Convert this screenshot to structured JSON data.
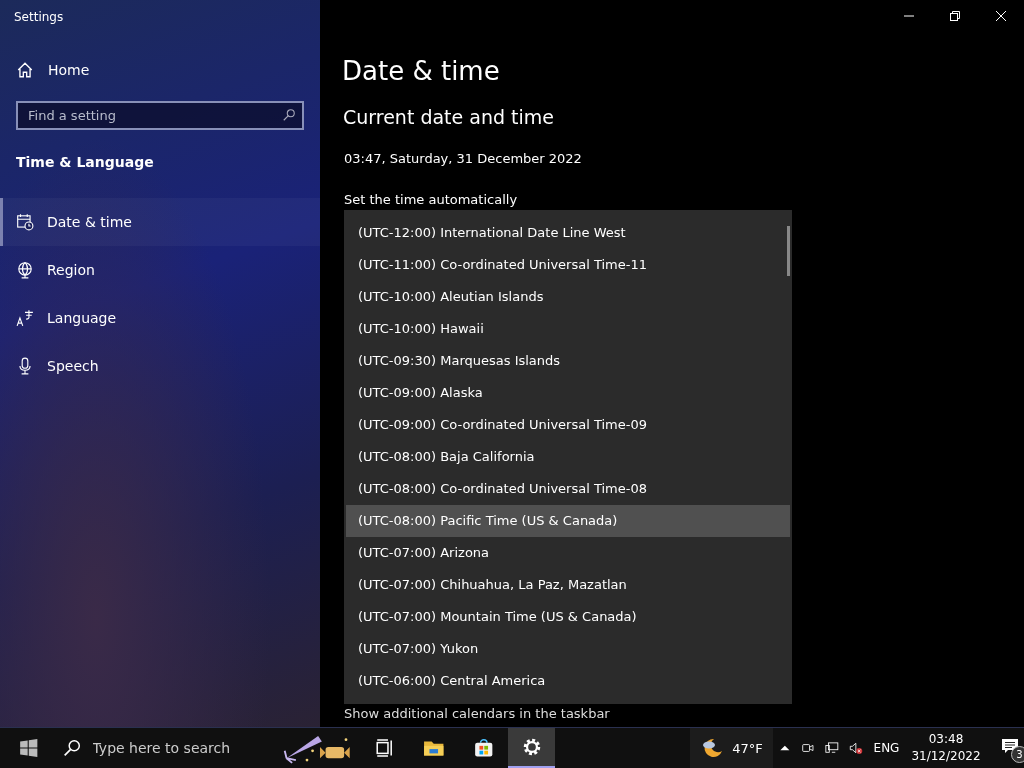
{
  "window": {
    "title": "Settings"
  },
  "sidebar": {
    "home": "Home",
    "search": {
      "placeholder": "Find a setting"
    },
    "section": "Time & Language",
    "items": [
      {
        "label": "Date & time",
        "kind": "calendar",
        "selected": true
      },
      {
        "label": "Region",
        "kind": "globe",
        "selected": false
      },
      {
        "label": "Language",
        "kind": "language",
        "selected": false
      },
      {
        "label": "Speech",
        "kind": "microphone",
        "selected": false
      }
    ]
  },
  "page": {
    "title": "Date & time",
    "heading": "Current date and time",
    "current": "03:47, Saturday, 31 December 2022",
    "auto_time_label": "Set the time automatically",
    "calendars_label": "Show additional calendars in the taskbar"
  },
  "timezone_dropdown": {
    "options": [
      {
        "label": "(UTC-12:00) International Date Line West",
        "selected": false
      },
      {
        "label": "(UTC-11:00) Co-ordinated Universal Time-11",
        "selected": false
      },
      {
        "label": "(UTC-10:00) Aleutian Islands",
        "selected": false
      },
      {
        "label": "(UTC-10:00) Hawaii",
        "selected": false
      },
      {
        "label": "(UTC-09:30) Marquesas Islands",
        "selected": false
      },
      {
        "label": "(UTC-09:00) Alaska",
        "selected": false
      },
      {
        "label": "(UTC-09:00) Co-ordinated Universal Time-09",
        "selected": false
      },
      {
        "label": "(UTC-08:00) Baja California",
        "selected": false
      },
      {
        "label": "(UTC-08:00) Co-ordinated Universal Time-08",
        "selected": false
      },
      {
        "label": "(UTC-08:00) Pacific Time (US & Canada)",
        "selected": true
      },
      {
        "label": "(UTC-07:00) Arizona",
        "selected": false
      },
      {
        "label": "(UTC-07:00) Chihuahua, La Paz, Mazatlan",
        "selected": false
      },
      {
        "label": "(UTC-07:00) Mountain Time (US & Canada)",
        "selected": false
      },
      {
        "label": "(UTC-07:00) Yukon",
        "selected": false
      },
      {
        "label": "(UTC-06:00) Central America",
        "selected": false
      }
    ]
  },
  "taskbar": {
    "search_placeholder": "Type here to search",
    "weather": "47°F",
    "language": "ENG",
    "time": "03:48",
    "date": "31/12/2022",
    "notification_count": "3"
  }
}
